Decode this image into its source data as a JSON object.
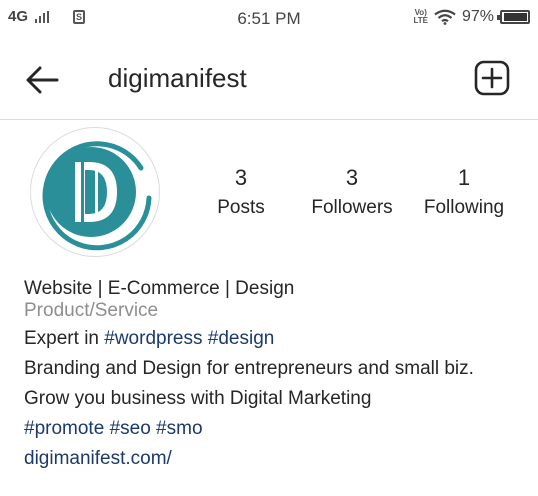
{
  "status_bar": {
    "network": "4G",
    "time": "6:51 PM",
    "volte_top": "Vo)",
    "volte_bottom": "LTE",
    "battery": "97%",
    "battery_level": 0.97
  },
  "header": {
    "username": "digimanifest"
  },
  "stats": [
    {
      "count": "3",
      "label": "Posts"
    },
    {
      "count": "3",
      "label": "Followers"
    },
    {
      "count": "1",
      "label": "Following"
    }
  ],
  "bio": {
    "name": "Website | E-Commerce | Design",
    "category": "Product/Service",
    "line1_prefix": "Expert in",
    "line1_tag1": "#wordpress",
    "line1_tag2": "#design",
    "line2": "Branding and Design for entrepreneurs and small biz.",
    "line3": "Grow you business with Digital Marketing",
    "tags": [
      "#promote",
      "#seo",
      "#smo"
    ],
    "website": "digimanifest.com/"
  },
  "colors": {
    "logo_teal": "#2a8f99",
    "hashtag": "#1b3a6b",
    "category": "#8e8e8e"
  },
  "icons": {
    "back": "back-arrow-icon",
    "add": "add-post-icon",
    "wifi": "wifi-icon",
    "sim": "sim-icon"
  }
}
